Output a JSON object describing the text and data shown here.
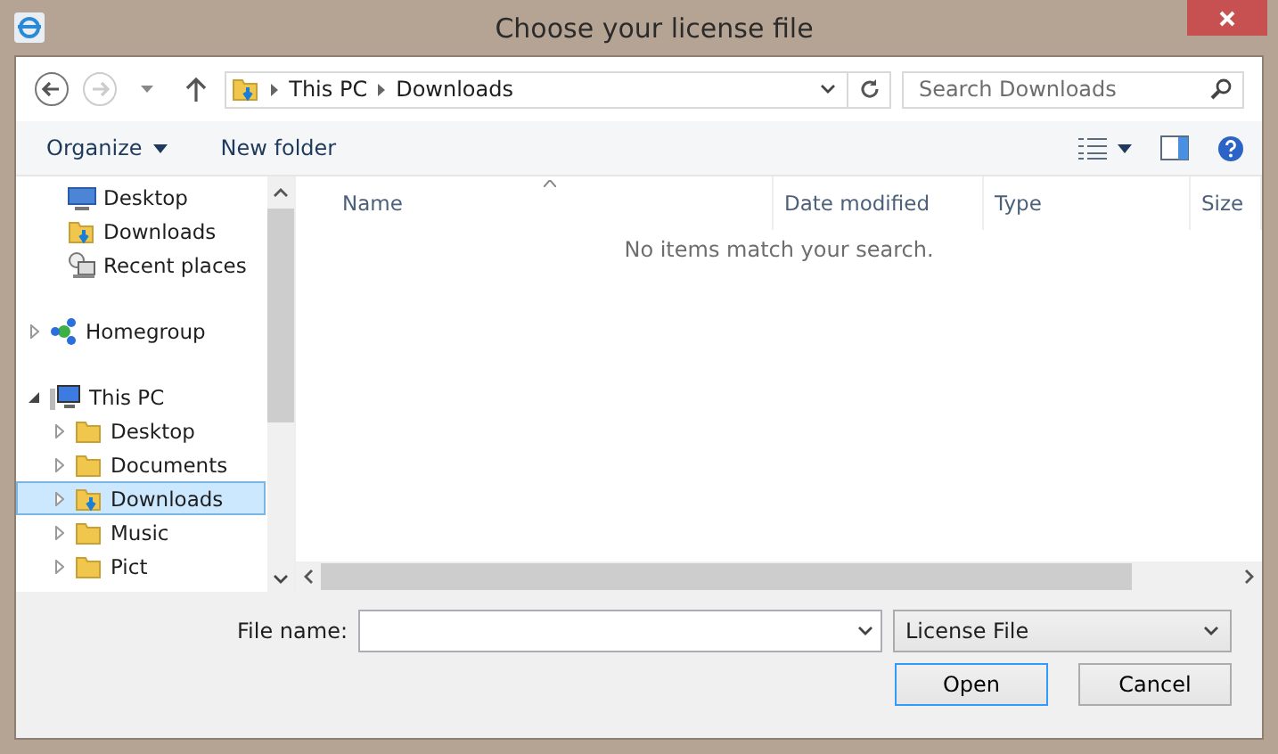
{
  "window": {
    "title": "Choose your license file"
  },
  "address": {
    "path": [
      "This PC",
      "Downloads"
    ],
    "search_placeholder": "Search Downloads"
  },
  "toolbar": {
    "items": [
      "Organize",
      "New folder"
    ]
  },
  "nav": {
    "favorites": [
      {
        "label": "Desktop",
        "kind": "desktop",
        "selected": false
      },
      {
        "label": "Downloads",
        "kind": "downloads",
        "selected": false
      },
      {
        "label": "Recent places",
        "kind": "recent",
        "selected": false
      }
    ],
    "tree": [
      {
        "label": "Homegroup",
        "kind": "network",
        "expanded": false,
        "selected": false
      },
      {
        "label": "This PC",
        "kind": "computer",
        "expanded": true,
        "selected": false,
        "children": [
          {
            "label": "Desktop",
            "kind": "folder",
            "expanded": false,
            "selected": false
          },
          {
            "label": "Documents",
            "kind": "folder",
            "expanded": false,
            "selected": false
          },
          {
            "label": "Downloads",
            "kind": "downloads",
            "expanded": false,
            "selected": true
          },
          {
            "label": "Music",
            "kind": "folder",
            "expanded": false,
            "selected": false
          },
          {
            "label": "Pict",
            "kind": "folder",
            "expanded": false,
            "selected": false
          }
        ]
      }
    ]
  },
  "table": {
    "columns": [
      "Name",
      "Date modified",
      "Type",
      "Size"
    ],
    "empty_message": "No items match your search."
  },
  "footer": {
    "file_name_label": "File name:",
    "file_type": "License File",
    "buttons": [
      "Open",
      "Cancel"
    ]
  }
}
